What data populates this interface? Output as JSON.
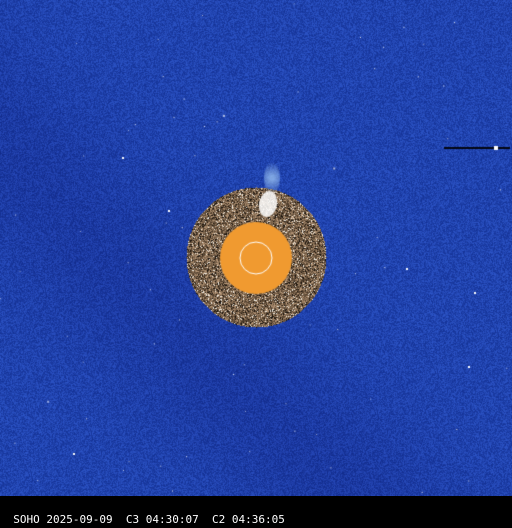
{
  "image": {
    "instrument": "SOHO",
    "date": "2025-09-09",
    "c3_label": "C3",
    "c3_time": "04:30:07",
    "c2_label": "C2",
    "c2_time": "04:36:05"
  },
  "colors": {
    "c3_background": "#1c3ca0",
    "c2_ring_base": "#6e5a48",
    "occulter_disk": "#f09a30",
    "sun_outline": "#ffffff",
    "footer_bg": "#000000",
    "footer_text": "#ffffff"
  }
}
